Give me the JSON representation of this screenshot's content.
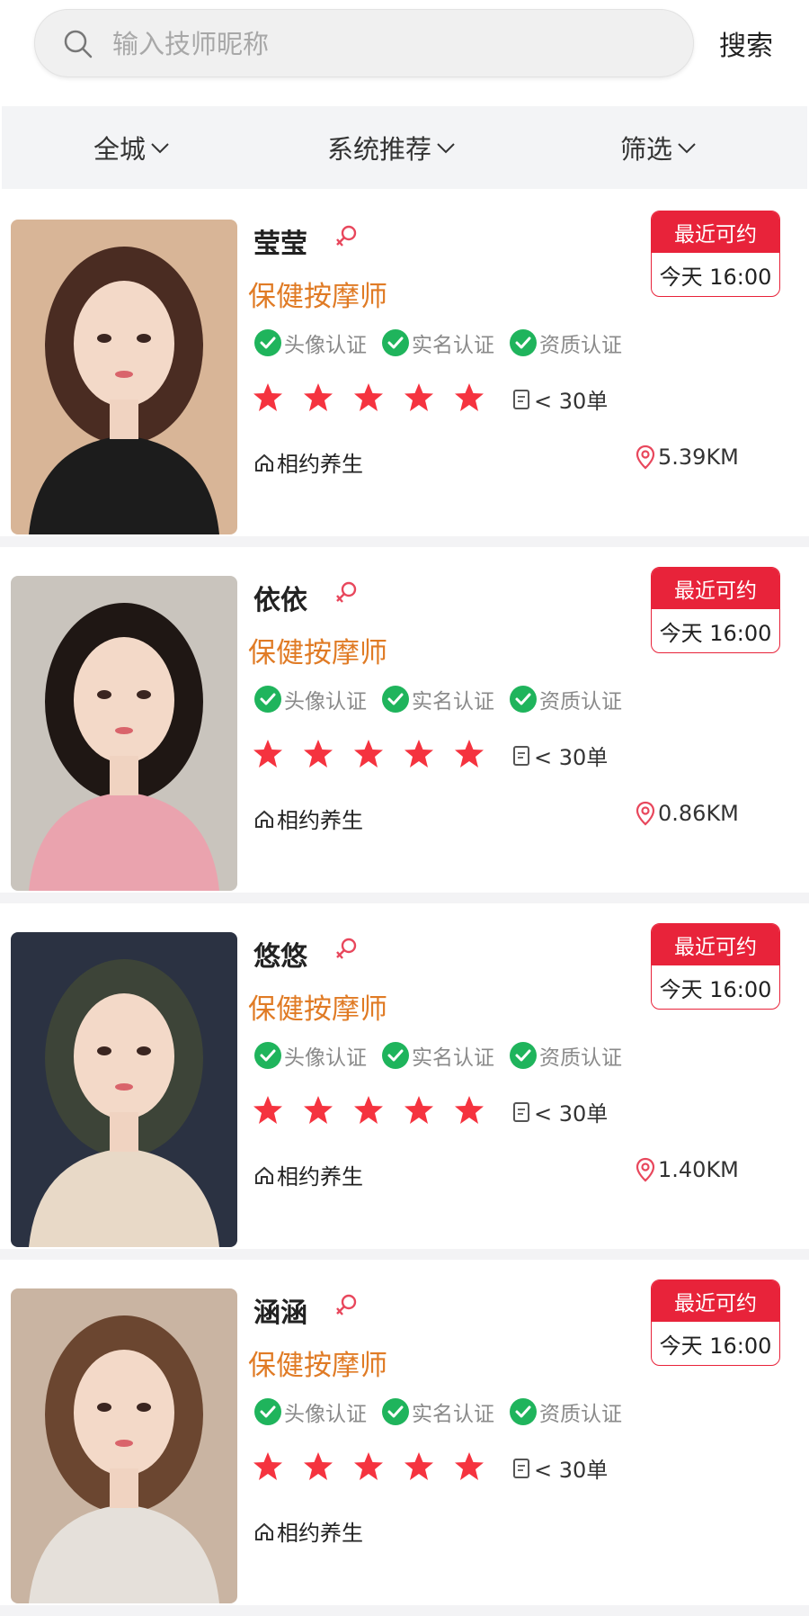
{
  "search": {
    "placeholder": "输入技师昵称",
    "button_label": "搜索"
  },
  "filters": [
    {
      "label": "全城"
    },
    {
      "label": "系统推荐"
    },
    {
      "label": "筛选"
    }
  ],
  "colors": {
    "accent_red": "#e8233a",
    "role_orange": "#e07b25",
    "badge_green": "#1fb45c",
    "star_red": "#f5333f"
  },
  "technicians": [
    {
      "name": "莹莹",
      "role": "保健按摩师",
      "badges": [
        "头像认证",
        "实名认证",
        "资质认证"
      ],
      "rating": 5,
      "orders": "< 30单",
      "shop": "相约养生",
      "distance": "5.39KM",
      "avail_label": "最近可约",
      "avail_time": "今天 16:00"
    },
    {
      "name": "依依",
      "role": "保健按摩师",
      "badges": [
        "头像认证",
        "实名认证",
        "资质认证"
      ],
      "rating": 5,
      "orders": "< 30单",
      "shop": "相约养生",
      "distance": "0.86KM",
      "avail_label": "最近可约",
      "avail_time": "今天 16:00"
    },
    {
      "name": "悠悠",
      "role": "保健按摩师",
      "badges": [
        "头像认证",
        "实名认证",
        "资质认证"
      ],
      "rating": 5,
      "orders": "< 30单",
      "shop": "相约养生",
      "distance": "1.40KM",
      "avail_label": "最近可约",
      "avail_time": "今天 16:00"
    },
    {
      "name": "涵涵",
      "role": "保健按摩师",
      "badges": [
        "头像认证",
        "实名认证",
        "资质认证"
      ],
      "rating": 5,
      "orders": "< 30单",
      "shop": "相约养生",
      "distance": "",
      "avail_label": "最近可约",
      "avail_time": "今天 16:00"
    }
  ]
}
